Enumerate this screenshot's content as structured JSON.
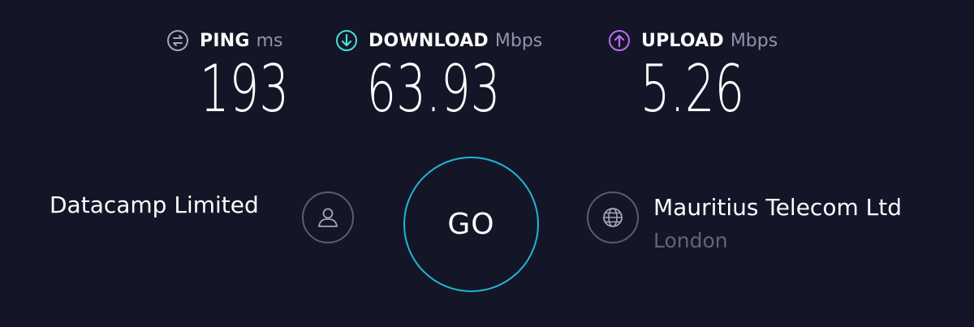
{
  "metrics": {
    "ping": {
      "name": "PING",
      "unit": "ms",
      "value": "193",
      "icon": "ping-icon",
      "color": "#a4a5b8"
    },
    "download": {
      "name": "DOWNLOAD",
      "unit": "Mbps",
      "value": "63.93",
      "icon": "download-arrow-icon",
      "color": "#45e0d3"
    },
    "upload": {
      "name": "UPLOAD",
      "unit": "Mbps",
      "value": "5.26",
      "icon": "upload-arrow-icon",
      "color": "#b86ff0"
    }
  },
  "isp": {
    "name": "Datacamp Limited",
    "icon": "user-icon"
  },
  "go_button": {
    "label": "GO",
    "color": "#1fb8cf"
  },
  "server": {
    "icon": "globe-icon",
    "name": "Mauritius Telecom Ltd",
    "location": "London"
  },
  "colors": {
    "background": "#141527",
    "muted_text": "#9193a8",
    "location_text": "#62647a"
  }
}
